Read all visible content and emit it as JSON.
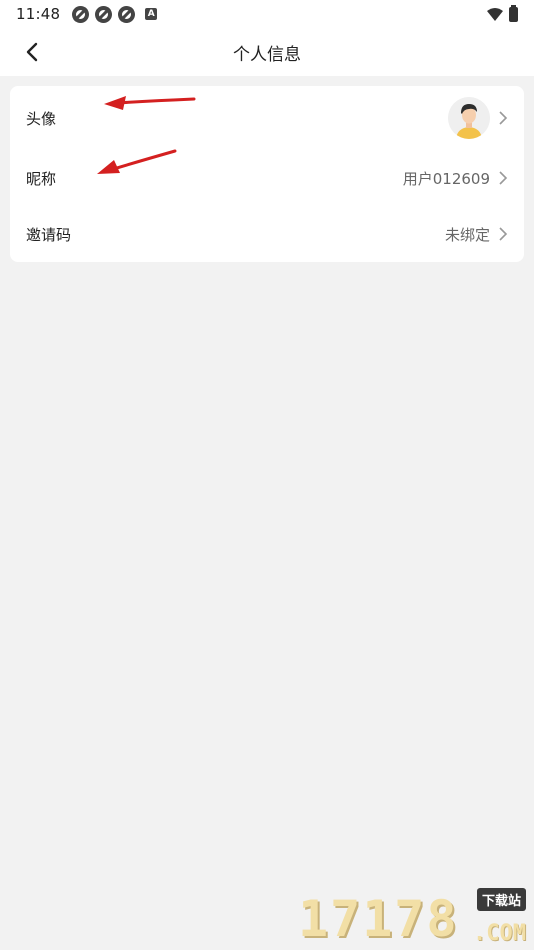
{
  "status_bar": {
    "time": "11:48",
    "notification_icons": [
      "aperture-icon",
      "aperture-icon",
      "aperture-icon"
    ],
    "a_badge": "A"
  },
  "header": {
    "title": "个人信息",
    "back_icon": "chevron-left-icon"
  },
  "profile": {
    "rows": [
      {
        "label": "头像",
        "value": "",
        "has_avatar": true
      },
      {
        "label": "昵称",
        "value": "用户012609"
      },
      {
        "label": "邀请码",
        "value": "未绑定"
      }
    ]
  },
  "colors": {
    "background": "#f2f2f2",
    "card": "#ffffff",
    "annotation_arrow": "#d42020",
    "watermark": "#f2dfa6"
  },
  "watermark": {
    "digits": "17178",
    "badge": "下载站",
    "suffix": ".COM"
  }
}
